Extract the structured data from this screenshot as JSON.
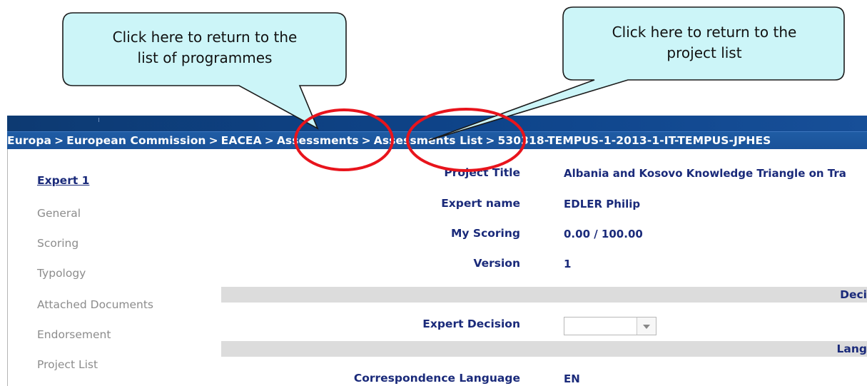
{
  "breadcrumb": {
    "items": [
      "Europa",
      "European Commission",
      "EACEA",
      "Assessments",
      "Assessments List",
      "530318-TEMPUS-1-2013-1-IT-TEMPUS-JPHES"
    ],
    "separator": ">"
  },
  "sidebar": {
    "items": [
      {
        "label": "Expert 1",
        "active": true
      },
      {
        "label": "General"
      },
      {
        "label": "Scoring"
      },
      {
        "label": "Typology"
      },
      {
        "label": "Attached Documents"
      },
      {
        "label": "Endorsement"
      },
      {
        "label": "Project List"
      }
    ]
  },
  "form": {
    "project_title_label": "Project Title",
    "project_title_value": "Albania and Kosovo Knowledge Triangle on Tra",
    "expert_name_label": "Expert name",
    "expert_name_value": "EDLER  Philip",
    "my_scoring_label": "My Scoring",
    "my_scoring_value": "0.00 / 100.00",
    "version_label": "Version",
    "version_value": "1",
    "decision_section": "Deci",
    "expert_decision_label": "Expert Decision",
    "expert_decision_value": "",
    "language_section": "Lang",
    "correspondence_language_label": "Correspondence Language",
    "correspondence_language_value": "EN"
  },
  "callouts": {
    "left": {
      "line1": "Click here to return to the",
      "line2": "list of programmes"
    },
    "right": {
      "line1": "Click here to return to the",
      "line2": "project list"
    }
  },
  "colors": {
    "header_dark": "#0e448a",
    "breadcrumb_bar": "#1f5ca4",
    "label_navy": "#1a2a7a",
    "callout_fill": "#ccf5f8",
    "highlight_red": "#e8141c",
    "section_gray": "#dcdcdc"
  }
}
